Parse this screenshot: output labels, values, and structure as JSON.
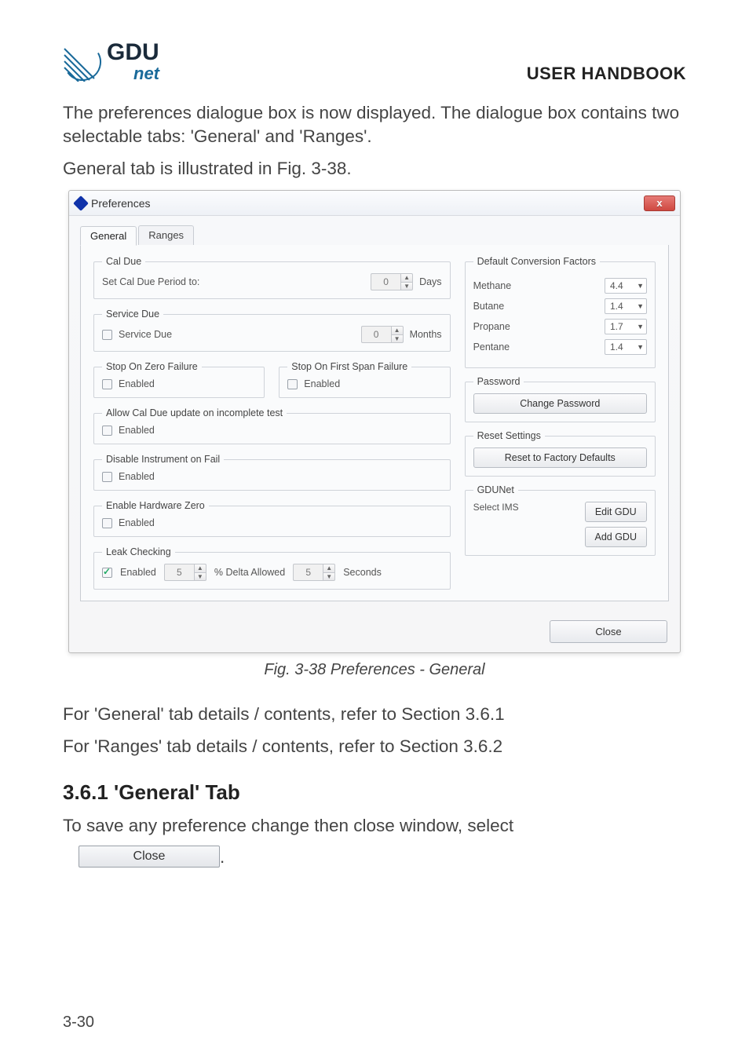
{
  "header": {
    "logo_top": "GDU",
    "logo_bottom": "net",
    "title": "USER HANDBOOK"
  },
  "intro_p1": "The preferences dialogue box is now displayed. The dialogue box contains two selectable tabs: 'General' and 'Ranges'.",
  "intro_p2": "General tab is illustrated in Fig. 3-38.",
  "dialog": {
    "title": "Preferences",
    "close_x": "x",
    "tabs": {
      "general": "General",
      "ranges": "Ranges"
    },
    "cal_due": {
      "legend": "Cal Due",
      "label": "Set Cal Due Period to:",
      "value": "0",
      "unit": "Days"
    },
    "service_due": {
      "legend": "Service Due",
      "checkbox": "Service Due",
      "value": "0",
      "unit": "Months"
    },
    "stop_zero": {
      "legend": "Stop On Zero Failure",
      "checkbox": "Enabled"
    },
    "stop_span": {
      "legend": "Stop On First Span Failure",
      "checkbox": "Enabled"
    },
    "allow_update": {
      "legend": "Allow Cal Due update on incomplete test",
      "checkbox": "Enabled"
    },
    "disable_fail": {
      "legend": "Disable Instrument on Fail",
      "checkbox": "Enabled"
    },
    "hw_zero": {
      "legend": "Enable Hardware Zero",
      "checkbox": "Enabled"
    },
    "leak": {
      "legend": "Leak Checking",
      "checkbox": "Enabled",
      "delta_val": "5",
      "delta_lbl": "% Delta Allowed",
      "sec_val": "5",
      "sec_lbl": "Seconds"
    },
    "factors": {
      "legend": "Default Conversion Factors",
      "methane_l": "Methane",
      "methane_v": "4.4",
      "butane_l": "Butane",
      "butane_v": "1.4",
      "propane_l": "Propane",
      "propane_v": "1.7",
      "pentane_l": "Pentane",
      "pentane_v": "1.4"
    },
    "password": {
      "legend": "Password",
      "button": "Change Password"
    },
    "reset": {
      "legend": "Reset Settings",
      "button": "Reset to Factory Defaults"
    },
    "gdunet": {
      "legend": "GDUNet",
      "select_l": "Select IMS",
      "edit": "Edit GDU",
      "add": "Add GDU"
    },
    "close": "Close"
  },
  "caption": "Fig. 3-38  Preferences - General",
  "ref1": "For 'General' tab details / contents, refer to Section 3.6.1",
  "ref2": "For 'Ranges' tab details / contents, refer to Section 3.6.2",
  "section_heading": "3.6.1  'General' Tab",
  "save_line": "To save any preference change then close window, select",
  "inline_close": "Close",
  "period": ".",
  "page_number": "3-30"
}
